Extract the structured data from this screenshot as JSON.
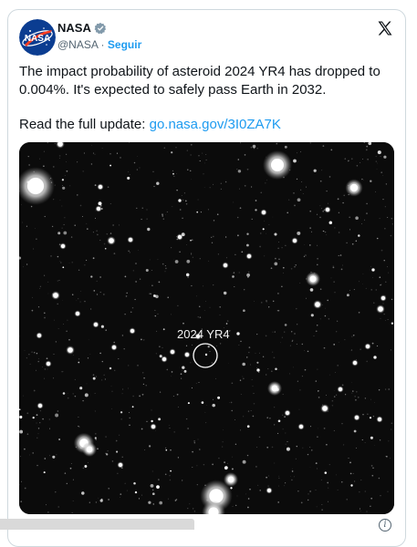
{
  "account": {
    "name": "NASA",
    "handle": "@NASA",
    "separator": "·",
    "follow_label": "Seguir",
    "avatar_icon": "nasa-meatball-logo",
    "verified_icon": "verified-badge-icon",
    "verified_color": "#829aab"
  },
  "brand_icon": "x-logo-icon",
  "tweet": {
    "text": "The impact probability of asteroid 2024 YR4 has dropped to 0.004%. It's expected to safely pass Earth in 2032.",
    "update_prefix": "Read the full update:",
    "link_text": "go.nasa.gov/3I0ZA7K",
    "link_color": "#1d9bf0"
  },
  "media": {
    "label": "2024 YR4",
    "background": "#0b0b0b"
  },
  "footer": {
    "info_glyph": "i"
  }
}
